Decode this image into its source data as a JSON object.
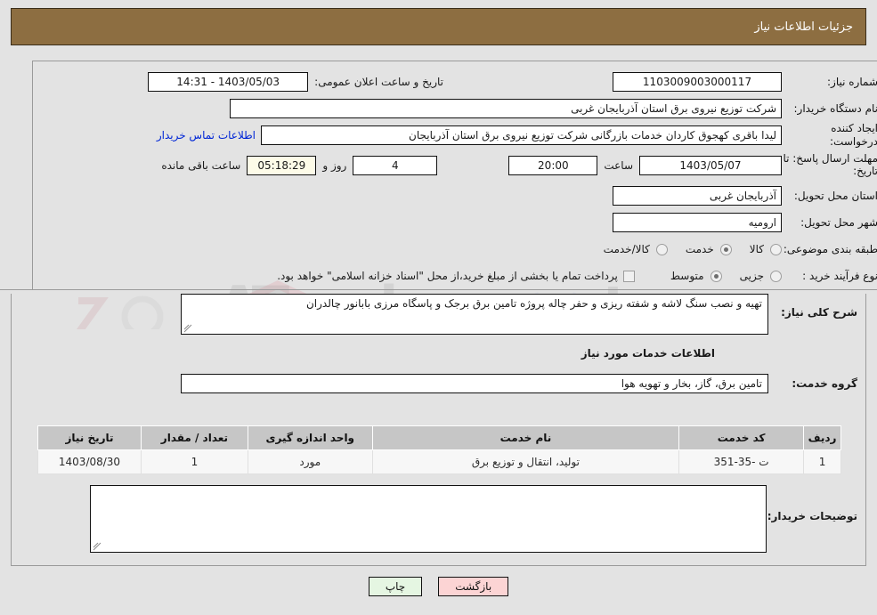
{
  "header": {
    "title": "جزئیات اطلاعات نیاز"
  },
  "form": {
    "need_number_label": "شماره نیاز:",
    "need_number_value": "1103009003000117",
    "announce_label": "تاریخ و ساعت اعلان عمومی:",
    "announce_value": "1403/05/03 - 14:31",
    "buyer_org_label": "نام دستگاه خریدار:",
    "buyer_org_value": "شرکت توزیع نیروی برق استان آذربایجان غربی",
    "creator_label": "ایجاد کننده درخواست:",
    "creator_value": "لیدا باقری کهجوق کاردان خدمات بازرگانی شرکت توزیع نیروی برق استان آذربایجان",
    "creator_link": "اطلاعات تماس خریدار",
    "deadline_label": "مهلت ارسال پاسخ: تا تاریخ:",
    "deadline_date": "1403/05/07",
    "deadline_time_label": "ساعت",
    "deadline_time": "20:00",
    "remaining_days": "4",
    "remaining_days_label": "روز و",
    "remaining_clock": "05:18:29",
    "remaining_suffix_label": "ساعت باقی مانده",
    "province_label": "استان محل تحویل:",
    "province_value": "آذربایجان غربی",
    "city_label": "شهر محل تحویل:",
    "city_value": "ارومیه",
    "category_label": "طبقه بندی موضوعی:",
    "category_options": [
      {
        "label": "کالا",
        "selected": false
      },
      {
        "label": "خدمت",
        "selected": true
      },
      {
        "label": "کالا/خدمت",
        "selected": false
      }
    ],
    "process_label": "نوع فرآیند خرید :",
    "process_options": [
      {
        "label": "جزیی",
        "selected": false
      },
      {
        "label": "متوسط",
        "selected": true
      }
    ],
    "treasury_note": "پرداخت تمام یا بخشی از مبلغ خرید،از محل \"اسناد خزانه اسلامی\" خواهد بود."
  },
  "description": {
    "need_label": "شرح کلی نیاز:",
    "need_value": "تهیه و نصب سنگ لاشه و شفته ریزی و حفر چاله پروژه تامین برق برجک و پاسگاه مرزی بابانور چالدران",
    "services_heading": "اطلاعات خدمات مورد نیاز",
    "group_label": "گروه خدمت:",
    "group_value": "تامین برق، گاز، بخار و تهویه هوا"
  },
  "table": {
    "columns": [
      "ردیف",
      "کد خدمت",
      "نام خدمت",
      "واحد اندازه گیری",
      "تعداد / مقدار",
      "تاریخ نیاز"
    ],
    "rows": [
      {
        "row": "1",
        "code": "ت -35-351",
        "name": "تولید، انتقال و توزیع برق",
        "unit": "مورد",
        "qty": "1",
        "date": "1403/08/30"
      }
    ]
  },
  "comments": {
    "label": "توضیحات خریدار:",
    "value": ""
  },
  "buttons": {
    "print": "چاپ",
    "back": "بازگشت"
  },
  "colors": {
    "header_brown": "#8d6e41",
    "page_bg": "#e3e3e3",
    "link_blue": "#0026d6",
    "back_btn": "#fcd4d4",
    "print_btn": "#e5f6e2",
    "countdown_bg": "#fdfbe8",
    "table_header": "#c6c6c6"
  }
}
